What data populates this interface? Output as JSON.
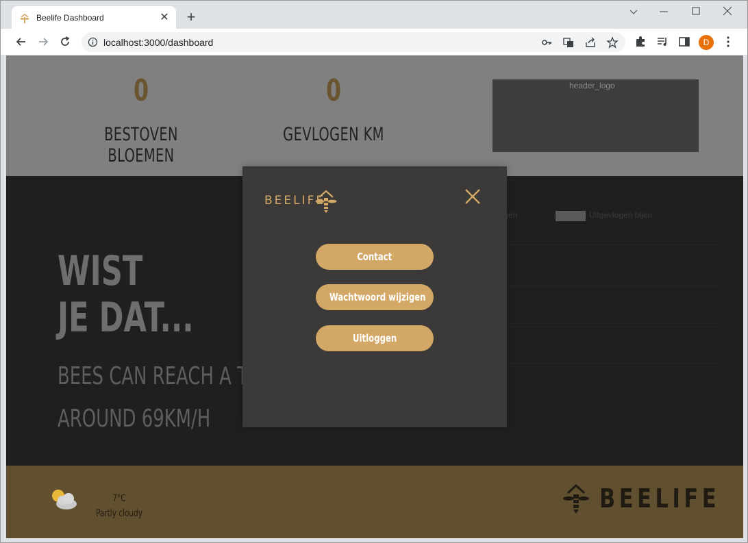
{
  "browser": {
    "tab_title": "Beelife Dashboard",
    "url": "localhost:3000/dashboard",
    "profile_initial": "D"
  },
  "stats": [
    {
      "value": "0",
      "label": "BESTOVEN BLOEMEN"
    },
    {
      "value": "0",
      "label": "GEVLOGEN KM"
    }
  ],
  "header_logo_alt": "header_logo",
  "chart_legend": {
    "item1": "Ingevlogen bijen",
    "item2": "Uitgevlogen bijen"
  },
  "fact": {
    "heading_line1": "WIST",
    "heading_line2": "JE DAT...",
    "line1": "BEES CAN REACH A TOP SPEED OF",
    "line2": "AROUND 69KM/H"
  },
  "weather": {
    "temperature": "7°C",
    "condition": "Partly cloudy",
    "icon": "partly-cloudy-icon"
  },
  "footer_brand": "BEELIFE",
  "modal": {
    "brand": "BEELIFE",
    "buttons": {
      "contact": "Contact",
      "change_password": "Wachtwoord wijzigen",
      "logout": "Uitloggen"
    }
  },
  "colors": {
    "accent": "#d3a866",
    "footer_bg": "#61502f",
    "modal_bg": "#3c3a38"
  }
}
